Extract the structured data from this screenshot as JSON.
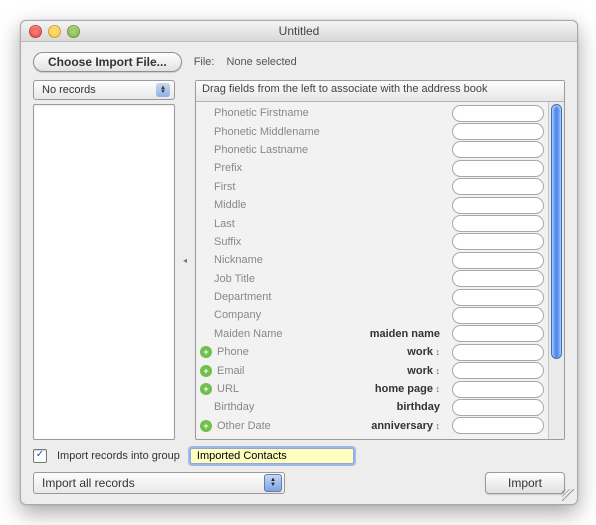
{
  "window": {
    "title": "Untitled"
  },
  "toolbar": {
    "choose_file_label": "Choose Import File...",
    "file_label": "File:",
    "file_value": "None selected"
  },
  "left": {
    "records_popup": "No records"
  },
  "right": {
    "header": "Drag fields from the left to associate with the address book",
    "fields": [
      {
        "label": "Phonetic Firstname",
        "assoc": "",
        "add": false
      },
      {
        "label": "Phonetic Middlename",
        "assoc": "",
        "add": false
      },
      {
        "label": "Phonetic Lastname",
        "assoc": "",
        "add": false
      },
      {
        "label": "Prefix",
        "assoc": "",
        "add": false
      },
      {
        "label": "First",
        "assoc": "",
        "add": false
      },
      {
        "label": "Middle",
        "assoc": "",
        "add": false
      },
      {
        "label": "Last",
        "assoc": "",
        "add": false
      },
      {
        "label": "Suffix",
        "assoc": "",
        "add": false
      },
      {
        "label": "Nickname",
        "assoc": "",
        "add": false
      },
      {
        "label": "Job Title",
        "assoc": "",
        "add": false
      },
      {
        "label": "Department",
        "assoc": "",
        "add": false
      },
      {
        "label": "Company",
        "assoc": "",
        "add": false
      },
      {
        "label": "Maiden Name",
        "assoc": "maiden name",
        "add": false,
        "dd": false
      },
      {
        "label": "Phone",
        "assoc": "work",
        "add": true,
        "dd": true
      },
      {
        "label": "Email",
        "assoc": "work",
        "add": true,
        "dd": true
      },
      {
        "label": "URL",
        "assoc": "home page",
        "add": true,
        "dd": true
      },
      {
        "label": "Birthday",
        "assoc": "birthday",
        "add": false,
        "dd": false
      },
      {
        "label": "Other Date",
        "assoc": "anniversary",
        "add": true,
        "dd": true
      }
    ]
  },
  "group": {
    "checkbox_label": "Import records into group",
    "checked": true,
    "name": "Imported Contacts"
  },
  "footer": {
    "scope_popup": "Import all records",
    "import_button": "Import"
  }
}
